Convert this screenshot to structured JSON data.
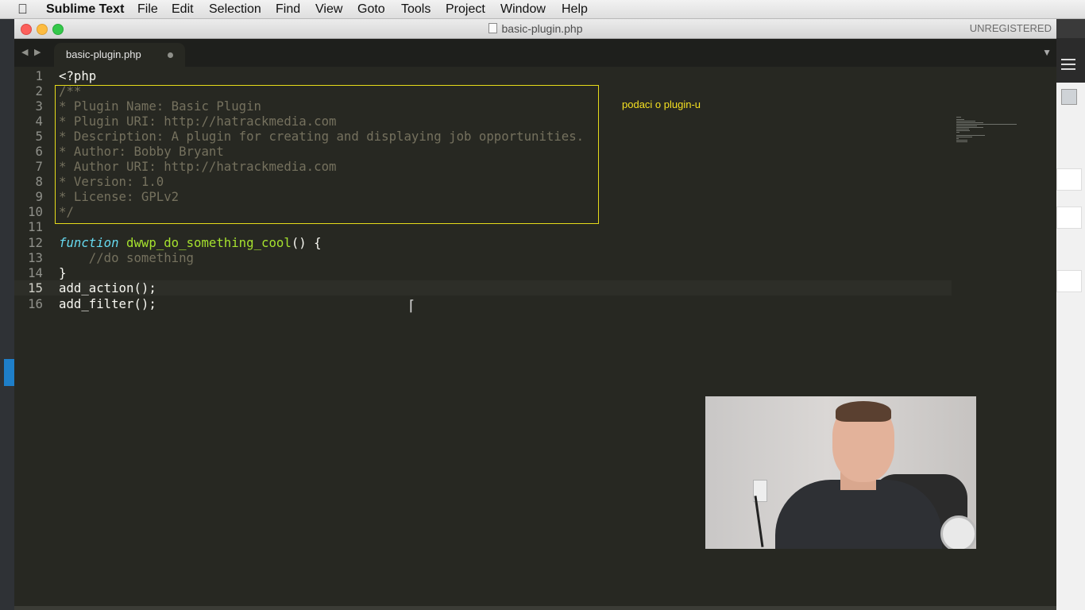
{
  "menubar": {
    "app_name": "Sublime Text",
    "items": [
      "File",
      "Edit",
      "Selection",
      "Find",
      "View",
      "Goto",
      "Tools",
      "Project",
      "Window",
      "Help"
    ]
  },
  "window": {
    "title": "basic-plugin.php",
    "license_status": "UNREGISTERED"
  },
  "tabs": [
    {
      "label": "basic-plugin.php",
      "active": true,
      "modified": true
    }
  ],
  "editor": {
    "lines": [
      {
        "n": "1",
        "text": "<?php"
      },
      {
        "n": "2",
        "text": "/**"
      },
      {
        "n": "3",
        "text": "* Plugin Name: Basic Plugin"
      },
      {
        "n": "4",
        "text": "* Plugin URI: http://hatrackmedia.com"
      },
      {
        "n": "5",
        "text": "* Description: A plugin for creating and displaying job opportunities."
      },
      {
        "n": "6",
        "text": "* Author: Bobby Bryant"
      },
      {
        "n": "7",
        "text": "* Author URI: http://hatrackmedia.com"
      },
      {
        "n": "8",
        "text": "* Version: 1.0"
      },
      {
        "n": "9",
        "text": "* License: GPLv2"
      },
      {
        "n": "10",
        "text": "*/"
      },
      {
        "n": "11",
        "text": ""
      },
      {
        "n": "12",
        "keyword": "function",
        "fn": "dwwp_do_something_cool",
        "rest": "() {"
      },
      {
        "n": "13",
        "text": "    //do something"
      },
      {
        "n": "14",
        "text": "}"
      },
      {
        "n": "15",
        "text": "add_action();"
      },
      {
        "n": "16",
        "text": "add_filter();"
      }
    ],
    "current_line": "15",
    "annotation": "podaci o plugin-u"
  },
  "colors": {
    "editor_bg": "#272822",
    "keyword": "#66d9ef",
    "function": "#a6e22e",
    "comment": "#75715e",
    "highlight_box": "#e6db1a",
    "annotation": "#f5e021"
  },
  "icons": {
    "apple": "apple-icon",
    "nav_back": "triangle-left-icon",
    "nav_forward": "triangle-right-icon",
    "tab_menu": "triangle-down-icon"
  }
}
